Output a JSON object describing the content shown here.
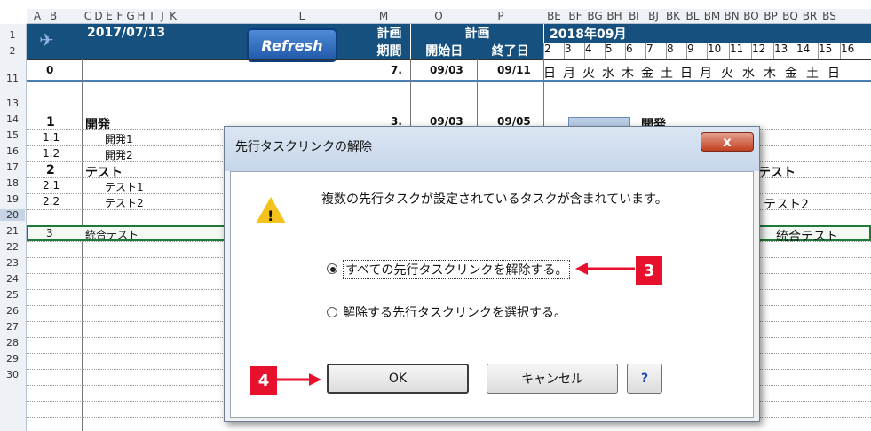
{
  "columns": [
    "A",
    "B",
    "C",
    "D",
    "E",
    "F",
    "G",
    "H",
    "I",
    "J",
    "K",
    "L",
    "M",
    "O",
    "P",
    "BE",
    "BF",
    "BG",
    "BH",
    "BI",
    "BJ",
    "BK",
    "BL",
    "BM",
    "BN",
    "BO",
    "BP",
    "BQ",
    "BR",
    "BS"
  ],
  "rows": [
    "1",
    "2",
    "11",
    "13",
    "14",
    "15",
    "16",
    "17",
    "18",
    "19",
    "20",
    "21",
    "22",
    "23",
    "24",
    "25",
    "26",
    "27",
    "28",
    "29",
    "30"
  ],
  "header": {
    "date": "2017/07/13",
    "refresh_label": "Refresh",
    "plan_period_top": "計画",
    "plan_period_bottom": "期間",
    "plan_top": "計画",
    "start_label": "開始日",
    "end_label": "終了日",
    "month_label": "2018年09月",
    "days": [
      "2",
      "3",
      "4",
      "5",
      "6",
      "7",
      "8",
      "9",
      "10",
      "11",
      "12",
      "13",
      "14",
      "15",
      "16"
    ],
    "weekdays": [
      "日",
      "月",
      "火",
      "水",
      "木",
      "金",
      "土",
      "日",
      "月",
      "火",
      "水",
      "木",
      "金",
      "土",
      "日"
    ]
  },
  "row11": {
    "id": "0",
    "period": "7.",
    "start": "09/03",
    "end": "09/11"
  },
  "tasks": [
    {
      "id": "1",
      "name": "開発",
      "period": "3.",
      "start": "09/03",
      "end": "09/05"
    },
    {
      "id": "1.1",
      "name": "開発1"
    },
    {
      "id": "1.2",
      "name": "開発2"
    },
    {
      "id": "2",
      "name": "テスト"
    },
    {
      "id": "2.1",
      "name": "テスト1"
    },
    {
      "id": "2.2",
      "name": "テスト2"
    },
    {
      "id": "3",
      "name": "統合テスト"
    }
  ],
  "gantt_labels": {
    "dev": "開発",
    "test": "テスト",
    "test2": "テスト2",
    "integ": "統合テスト"
  },
  "dialog": {
    "title": "先行タスクリンクの解除",
    "close": "x",
    "message": "複数の先行タスクが設定されているタスクが含まれています。",
    "option1": "すべての先行タスクリンクを解除する。",
    "option2": "解除する先行タスクリンクを選択する。",
    "selected_option": 1,
    "ok_label": "OK",
    "cancel_label": "キャンセル",
    "help_label": "?",
    "warning_glyph": "!"
  },
  "annotations": {
    "badge3": "3",
    "badge4": "4"
  },
  "colors": {
    "header_blue": "#15507e",
    "annotation_red": "#e8112d",
    "gantt_bar": "#b9cde6"
  }
}
